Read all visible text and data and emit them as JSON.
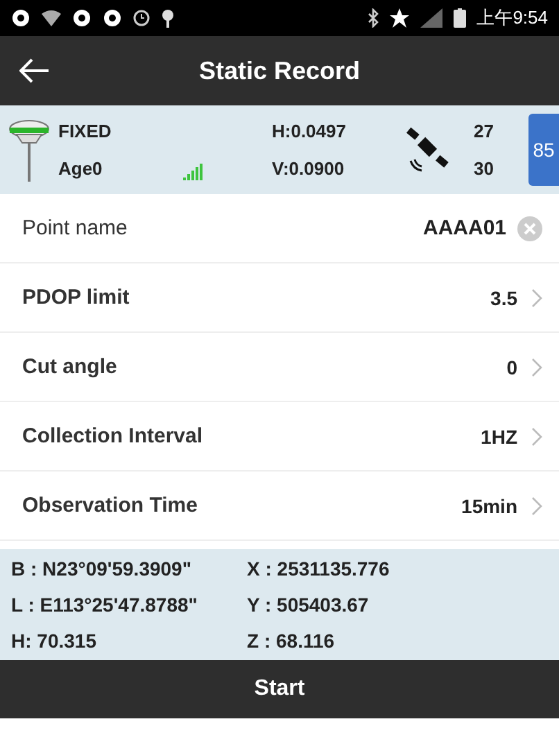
{
  "status_bar": {
    "time": "上午9:54"
  },
  "title_bar": {
    "title": "Static Record"
  },
  "info": {
    "solution": "FIXED",
    "age": "Age0",
    "h_precision": "H:0.0497",
    "v_precision": "V:0.0900",
    "satellites_used": "27",
    "satellites_visible": "30",
    "battery": "85"
  },
  "settings": [
    {
      "kind": "input",
      "label": "Point name",
      "value": "AAAA01"
    },
    {
      "kind": "select",
      "label": "PDOP limit",
      "value": "3.5"
    },
    {
      "kind": "select",
      "label": "Cut angle",
      "value": "0"
    },
    {
      "kind": "select",
      "label": "Collection Interval",
      "value": "1HZ"
    },
    {
      "kind": "select",
      "label": "Observation Time",
      "value": "15min"
    }
  ],
  "coordinates": [
    {
      "left": "B : N23°09'59.3909\"",
      "right": "X : 2531135.776"
    },
    {
      "left": "L : E113°25'47.8788\"",
      "right": "Y : 505403.67"
    },
    {
      "left": "H: 70.315",
      "right": "Z : 68.116"
    }
  ],
  "start_button": {
    "label": "Start"
  }
}
